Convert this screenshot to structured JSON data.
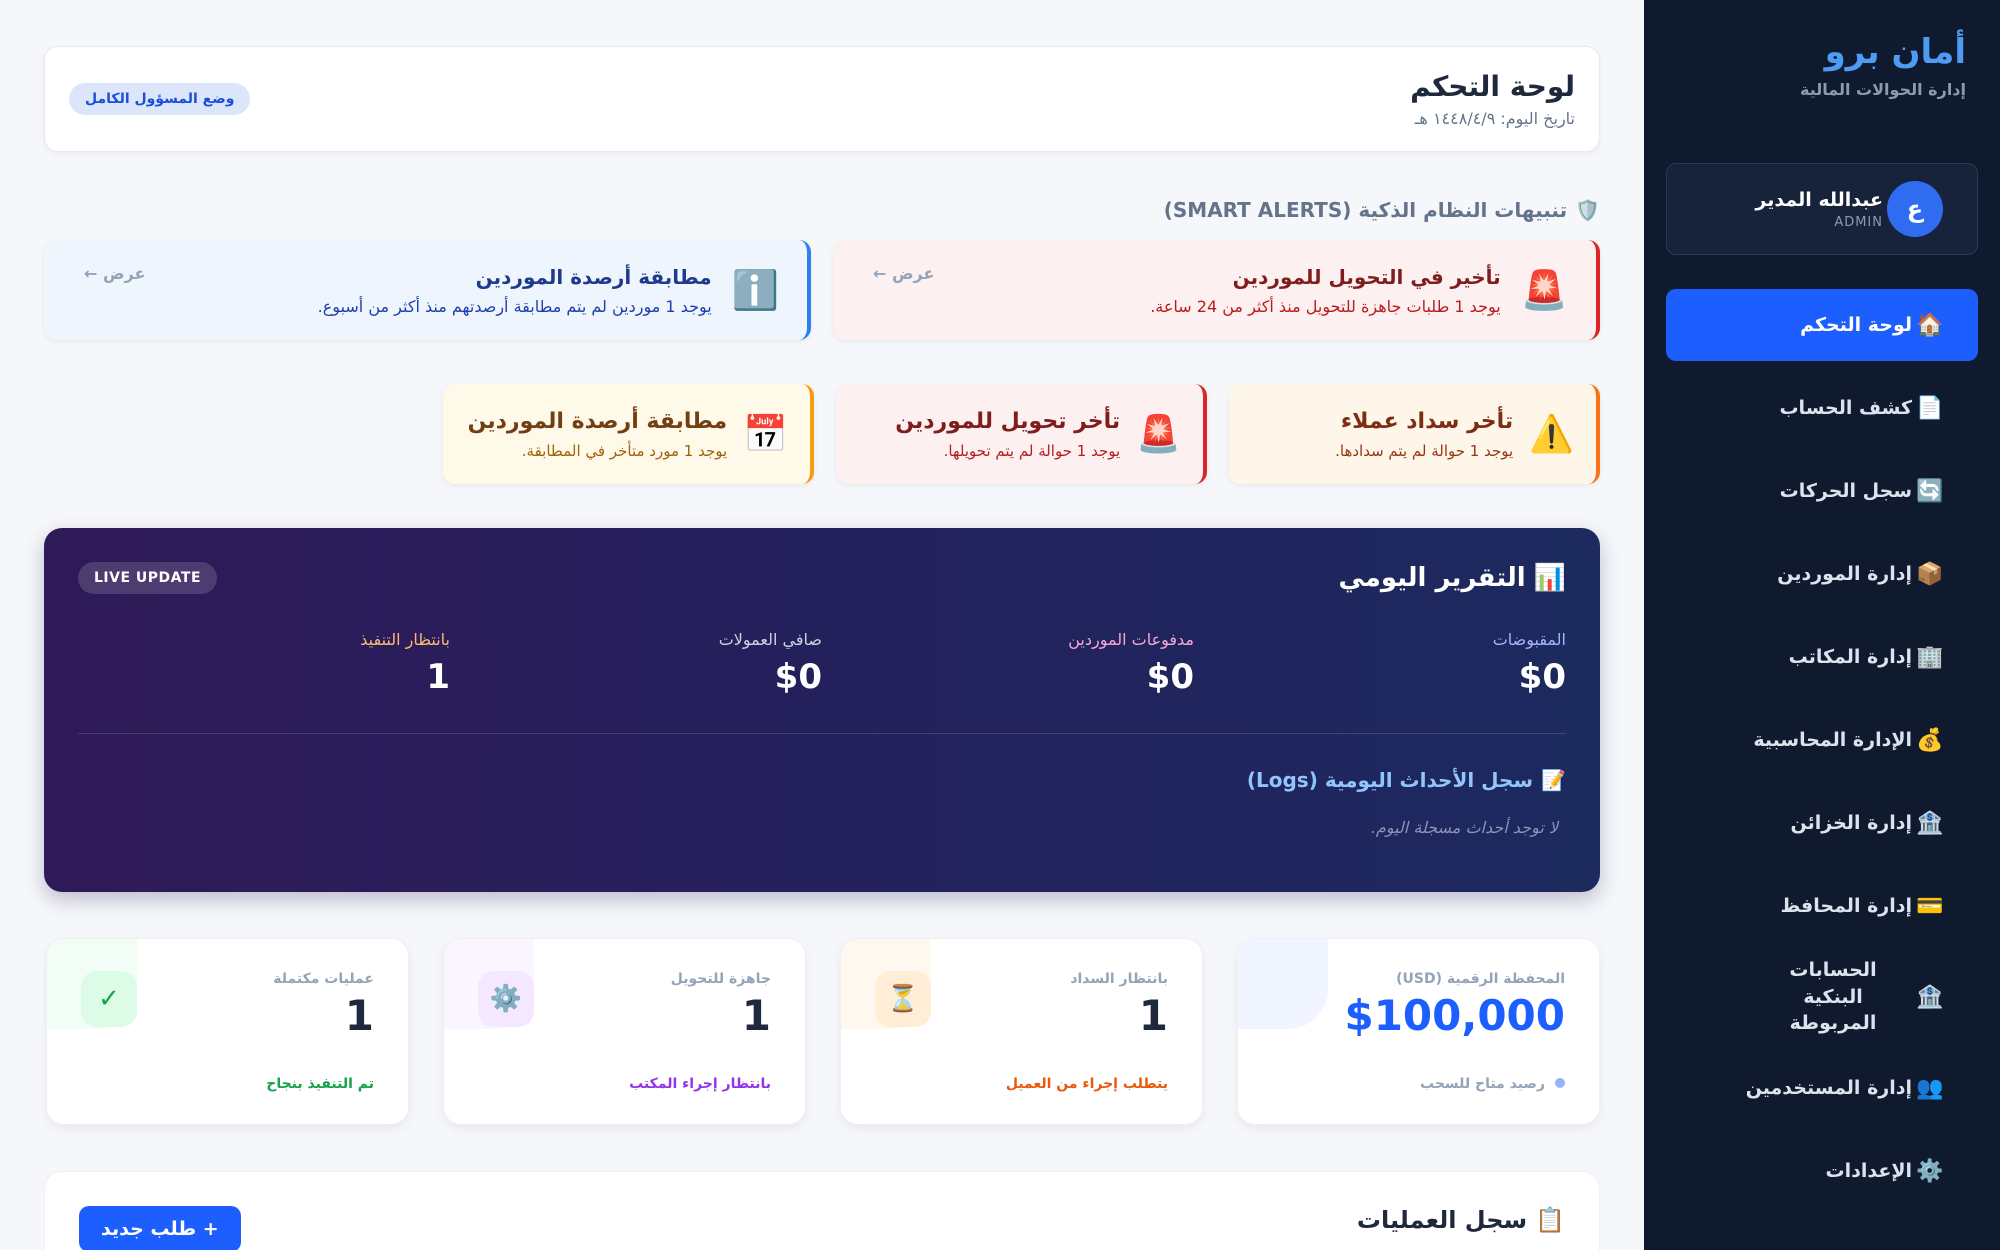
{
  "brand": {
    "title": "أمان برو",
    "subtitle": "إدارة الحوالات المالية"
  },
  "user": {
    "initial": "ع",
    "name": "عبدالله المدير",
    "role": "ADMIN"
  },
  "nav": [
    {
      "icon": "🏠",
      "label": "لوحة التحكم",
      "active": true
    },
    {
      "icon": "📄",
      "label": "كشف الحساب"
    },
    {
      "icon": "🔄",
      "label": "سجل الحركات"
    },
    {
      "icon": "📦",
      "label": "إدارة الموردين"
    },
    {
      "icon": "🏢",
      "label": "إدارة المكاتب"
    },
    {
      "icon": "💰",
      "label": "الإدارة المحاسبية"
    },
    {
      "icon": "🏦",
      "label": "إدارة الخزائن"
    },
    {
      "icon": "💳",
      "label": "إدارة المحافظ"
    },
    {
      "icon": "🏦",
      "label": "الحسابات البنكية المربوطة"
    },
    {
      "icon": "👥",
      "label": "إدارة المستخدمين"
    },
    {
      "icon": "⚙️",
      "label": "الإعدادات"
    }
  ],
  "header": {
    "title": "لوحة التحكم",
    "date": "تاريخ اليوم: ١٤٤٨/٤/٩ هـ",
    "badge": "وضع المسؤول الكامل"
  },
  "alerts": {
    "section_title": "تنبيهات النظام الذكية (SMART ALERTS)",
    "section_icon": "🛡️",
    "big": [
      {
        "icon": "🚨",
        "title": "تأخير في التحويل للموردين",
        "text": "يوجد 1 طلبات جاهزة للتحويل منذ أكثر من 24 ساعة.",
        "link": "عرض ←"
      },
      {
        "icon": "ℹ️",
        "title": "مطابقة أرصدة الموردين",
        "text": "يوجد 1 موردين لم يتم مطابقة أرصدتهم منذ أكثر من أسبوع.",
        "link": "عرض ←"
      }
    ],
    "small": [
      {
        "icon": "⚠️",
        "title": "تأخر سداد عملاء",
        "text": "يوجد 1 حوالة لم يتم سدادها."
      },
      {
        "icon": "🚨",
        "title": "تأخر تحويل للموردين",
        "text": "يوجد 1 حوالة لم يتم تحويلها."
      },
      {
        "icon": "📅",
        "title": "مطابقة أرصدة الموردين",
        "text": "يوجد 1 مورد متأخر في المطابقة."
      }
    ]
  },
  "report": {
    "icon": "📊",
    "title": "التقرير اليومي",
    "live": "LIVE UPDATE",
    "stats": [
      {
        "label": "المقبوضات",
        "value": "$0",
        "color": "#a5b4fc"
      },
      {
        "label": "مدفوعات الموردين",
        "value": "$0",
        "color": "#f9a8d4"
      },
      {
        "label": "صافي العمولات",
        "value": "$0",
        "color": "#cbd5e1"
      },
      {
        "label": "بانتظار التنفيذ",
        "value": "1",
        "color": "#fdba74"
      }
    ],
    "logs_icon": "📝",
    "logs_title": "سجل الأحداث اليومية (Logs)",
    "logs_empty": "لا توجد أحداث مسجلة اليوم."
  },
  "kpis": [
    {
      "label": "المحفظة الرقمية (USD)",
      "value": "$100,000",
      "foot": "رصيد متاح للسحب",
      "valueColor": "#1d5ffe",
      "footColor": "#94a3b8",
      "icon": "",
      "iconBg": "",
      "blob": "#e8efff"
    },
    {
      "label": "بانتظار السداد",
      "value": "1",
      "foot": "يتطلب إجراء من العميل",
      "valueColor": "#1e293b",
      "footColor": "#ea580c",
      "icon": "⏳",
      "iconBg": "#ffedd5",
      "blob": "#fff4e5"
    },
    {
      "label": "جاهزة للتحويل",
      "value": "1",
      "foot": "بانتظار إجراء المكتب",
      "valueColor": "#1e293b",
      "footColor": "#9333ea",
      "icon": "⚙️",
      "iconBg": "#f3e8ff",
      "blob": "#f7efff"
    },
    {
      "label": "عمليات مكتملة",
      "value": "1",
      "foot": "تم التنفيذ بنجاح",
      "valueColor": "#1e293b",
      "footColor": "#16a34a",
      "icon": "✓",
      "iconBg": "#dcfce7",
      "blob": "#eafbf0"
    }
  ],
  "ops": {
    "icon": "📋",
    "title": "سجل العمليات",
    "new_button": "+ طلب جديد"
  }
}
